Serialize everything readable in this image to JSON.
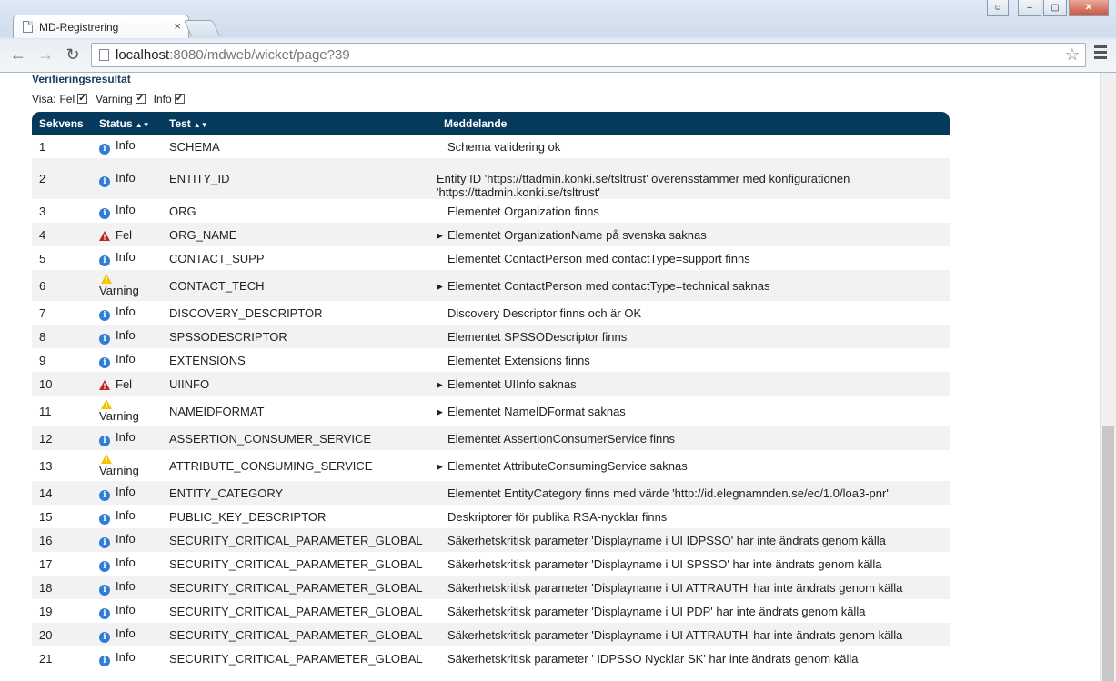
{
  "browser": {
    "tab_title": "MD-Registrering",
    "tab_close": "×",
    "url_host": "localhost",
    "url_rest": ":8080/mdweb/wicket/page?39",
    "back_icon": "arrow-left-icon",
    "forward_icon": "arrow-right-icon",
    "reload_icon": "reload-icon"
  },
  "page": {
    "section_title": "Verifieringsresultat",
    "filters": {
      "label": "Visa:",
      "items": [
        {
          "label": "Fel",
          "checked": true
        },
        {
          "label": "Varning",
          "checked": true
        },
        {
          "label": "Info",
          "checked": true
        }
      ]
    },
    "table": {
      "headers": {
        "seq": "Sekvens",
        "status": "Status",
        "test": "Test",
        "message": "Meddelande"
      },
      "rows": [
        {
          "seq": "1",
          "status": "Info",
          "test": "SCHEMA",
          "message": "Schema validering ok",
          "expandable": false
        },
        {
          "seq": "2",
          "status": "Info",
          "test": "ENTITY_ID",
          "message": "Entity ID 'https://ttadmin.konki.se/tsltrust' överensstämmer med konfigurationen 'https://ttadmin.konki.se/tsltrust'",
          "expandable": false
        },
        {
          "seq": "3",
          "status": "Info",
          "test": "ORG",
          "message": "Elementet Organization finns",
          "expandable": false
        },
        {
          "seq": "4",
          "status": "Fel",
          "test": "ORG_NAME",
          "message": "Elementet OrganizationName på svenska saknas",
          "expandable": true
        },
        {
          "seq": "5",
          "status": "Info",
          "test": "CONTACT_SUPP",
          "message": "Elementet ContactPerson med contactType=support finns",
          "expandable": false
        },
        {
          "seq": "6",
          "status": "Varning",
          "test": "CONTACT_TECH",
          "message": "Elementet ContactPerson med contactType=technical saknas",
          "expandable": true
        },
        {
          "seq": "7",
          "status": "Info",
          "test": "DISCOVERY_DESCRIPTOR",
          "message": "Discovery Descriptor finns och är OK",
          "expandable": false
        },
        {
          "seq": "8",
          "status": "Info",
          "test": "SPSSODESCRIPTOR",
          "message": "Elementet SPSSODescriptor finns",
          "expandable": false
        },
        {
          "seq": "9",
          "status": "Info",
          "test": "EXTENSIONS",
          "message": "Elementet Extensions finns",
          "expandable": false
        },
        {
          "seq": "10",
          "status": "Fel",
          "test": "UIINFO",
          "message": "Elementet UIInfo saknas",
          "expandable": true
        },
        {
          "seq": "11",
          "status": "Varning",
          "test": "NAMEIDFORMAT",
          "message": "Elementet NameIDFormat saknas",
          "expandable": true
        },
        {
          "seq": "12",
          "status": "Info",
          "test": "ASSERTION_CONSUMER_SERVICE",
          "message": "Elementet AssertionConsumerService finns",
          "expandable": false
        },
        {
          "seq": "13",
          "status": "Varning",
          "test": "ATTRIBUTE_CONSUMING_SERVICE",
          "message": "Elementet AttributeConsumingService saknas",
          "expandable": true
        },
        {
          "seq": "14",
          "status": "Info",
          "test": "ENTITY_CATEGORY",
          "message": "Elementet EntityCategory finns med värde 'http://id.elegnamnden.se/ec/1.0/loa3-pnr'",
          "expandable": false
        },
        {
          "seq": "15",
          "status": "Info",
          "test": "PUBLIC_KEY_DESCRIPTOR",
          "message": "Deskriptorer för publika RSA-nycklar finns",
          "expandable": false
        },
        {
          "seq": "16",
          "status": "Info",
          "test": "SECURITY_CRITICAL_PARAMETER_GLOBAL",
          "message": "Säkerhetskritisk parameter 'Displayname i UI IDPSSO' har inte ändrats genom källa",
          "expandable": false
        },
        {
          "seq": "17",
          "status": "Info",
          "test": "SECURITY_CRITICAL_PARAMETER_GLOBAL",
          "message": "Säkerhetskritisk parameter 'Displayname i UI SPSSO' har inte ändrats genom källa",
          "expandable": false
        },
        {
          "seq": "18",
          "status": "Info",
          "test": "SECURITY_CRITICAL_PARAMETER_GLOBAL",
          "message": "Säkerhetskritisk parameter 'Displayname i UI ATTRAUTH' har inte ändrats genom källa",
          "expandable": false
        },
        {
          "seq": "19",
          "status": "Info",
          "test": "SECURITY_CRITICAL_PARAMETER_GLOBAL",
          "message": "Säkerhetskritisk parameter 'Displayname i UI PDP' har inte ändrats genom källa",
          "expandable": false
        },
        {
          "seq": "20",
          "status": "Info",
          "test": "SECURITY_CRITICAL_PARAMETER_GLOBAL",
          "message": "Säkerhetskritisk parameter 'Displayname i UI ATTRAUTH' har inte ändrats genom källa",
          "expandable": false
        },
        {
          "seq": "21",
          "status": "Info",
          "test": "SECURITY_CRITICAL_PARAMETER_GLOBAL",
          "message": "Säkerhetskritisk parameter ' IDPSSO Nycklar SK' har inte ändrats genom källa",
          "expandable": false
        }
      ]
    }
  },
  "colors": {
    "header_bg": "#053a5d",
    "info_icon": "#2f7dd6",
    "error_icon": "#c0271c",
    "warning_icon": "#f2c300",
    "title": "#1c3c63"
  }
}
